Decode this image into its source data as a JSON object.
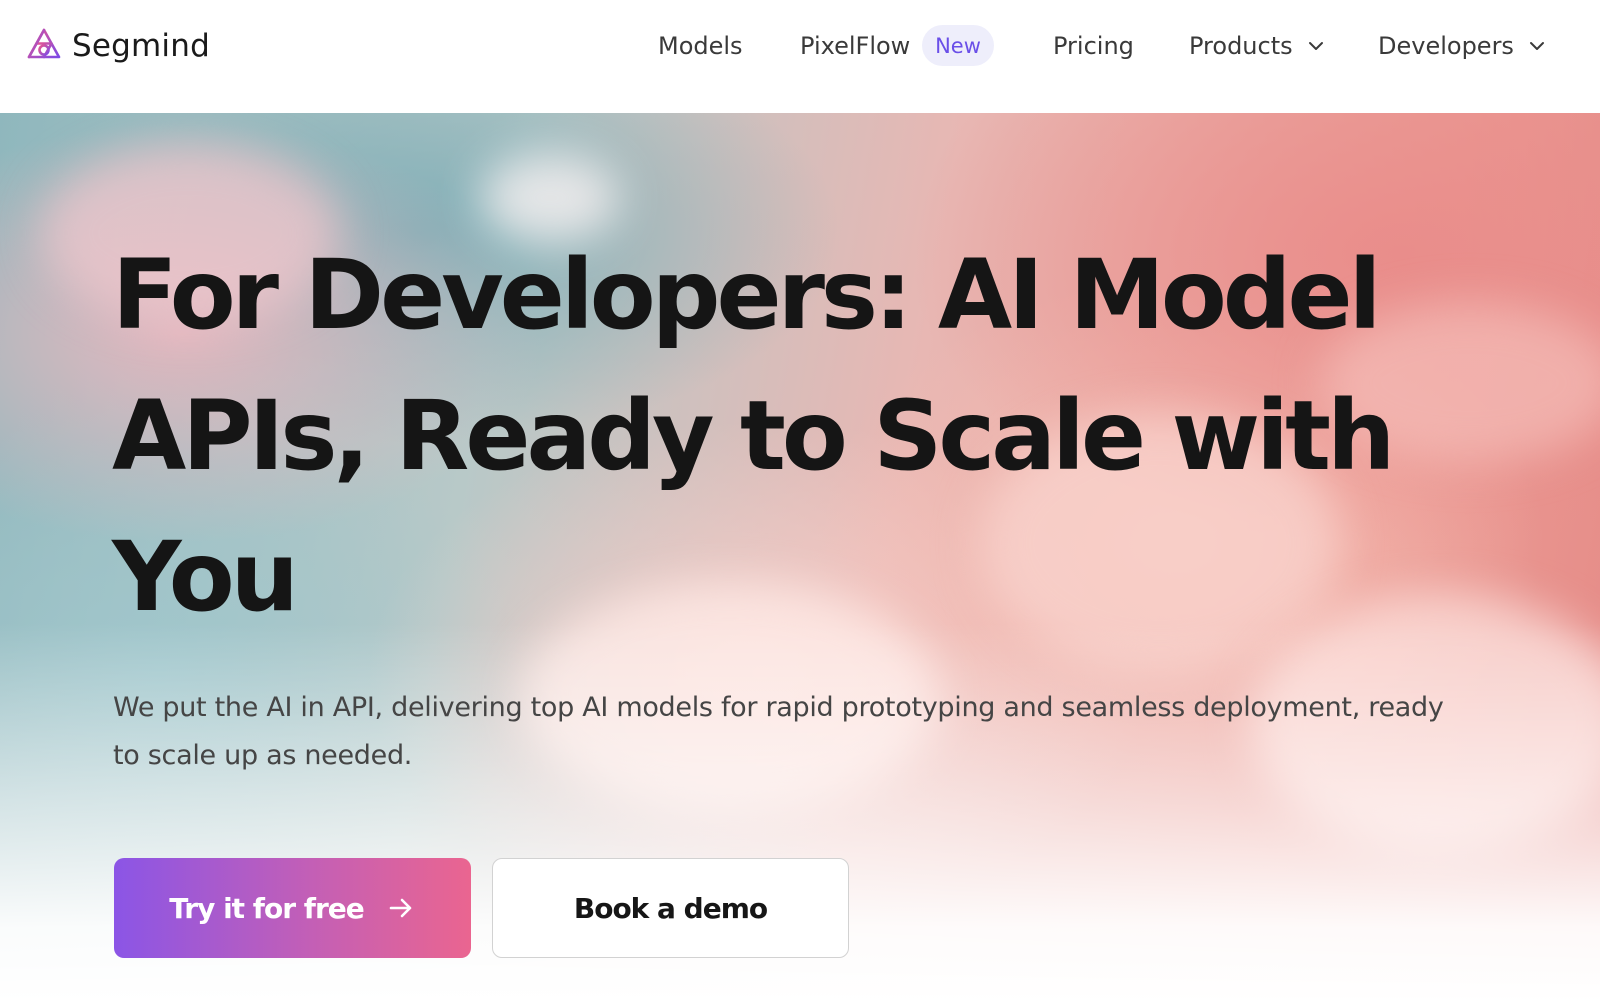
{
  "brand": {
    "name": "Segmind",
    "logo_icon": "segmind-logo-icon",
    "accent_gradient": [
      "#8b55e6",
      "#ea6590"
    ]
  },
  "nav": {
    "models": "Models",
    "pixelflow": "PixelFlow",
    "pixelflow_badge": "New",
    "pricing": "Pricing",
    "products": "Products",
    "developers": "Developers",
    "dropdown_icon": "chevron-down-icon"
  },
  "hero": {
    "headline": "For Developers: AI Model APIs, Ready to Scale with You",
    "subtext": "We put the AI in API, delivering top AI models for rapid prototyping and seamless deployment, ready to scale up as needed.",
    "primary_button": "Try it for free",
    "primary_button_icon": "arrow-right-icon",
    "secondary_button": "Book a demo",
    "background": "pastel-cloud-sky-image"
  },
  "colors": {
    "badge_bg": "#eeeefb",
    "badge_text": "#6a4fe8",
    "headline": "#151515"
  }
}
